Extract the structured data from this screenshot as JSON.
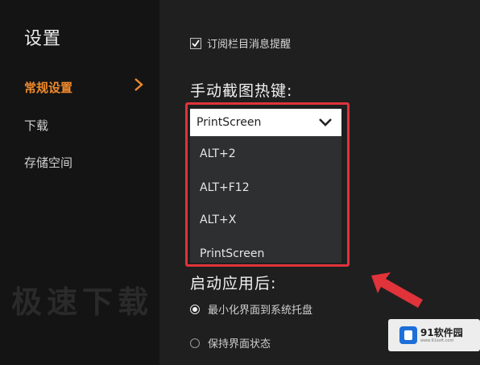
{
  "sidebar": {
    "title": "设置",
    "items": [
      {
        "label": "常规设置",
        "active": true
      },
      {
        "label": "下载",
        "active": false
      },
      {
        "label": "存储空间",
        "active": false
      }
    ]
  },
  "main": {
    "subscribe_checkbox": {
      "label": "订阅栏目消息提醒",
      "checked": true
    },
    "hotkey_title": "手动截图热键:",
    "hotkey_select": {
      "value": "PrintScreen",
      "options": [
        "ALT+2",
        "ALT+F12",
        "ALT+X",
        "PrintScreen"
      ]
    },
    "launch_title": "启动应用后:",
    "launch_options": [
      {
        "label": "最小化界面到系统托盘",
        "checked": true
      },
      {
        "label": "保持界面状态",
        "checked": false
      }
    ],
    "faded_text": "极速下载"
  },
  "watermark": {
    "brand": "91软件园",
    "url": "www.91soft.com"
  },
  "colors": {
    "accent": "#f08a2c",
    "highlight": "#e0333a",
    "background": "#1f1f1f",
    "sidebar": "#141414"
  },
  "icons": [
    "chevron-right-icon",
    "chevron-down-icon",
    "check-icon",
    "red-arrow"
  ]
}
